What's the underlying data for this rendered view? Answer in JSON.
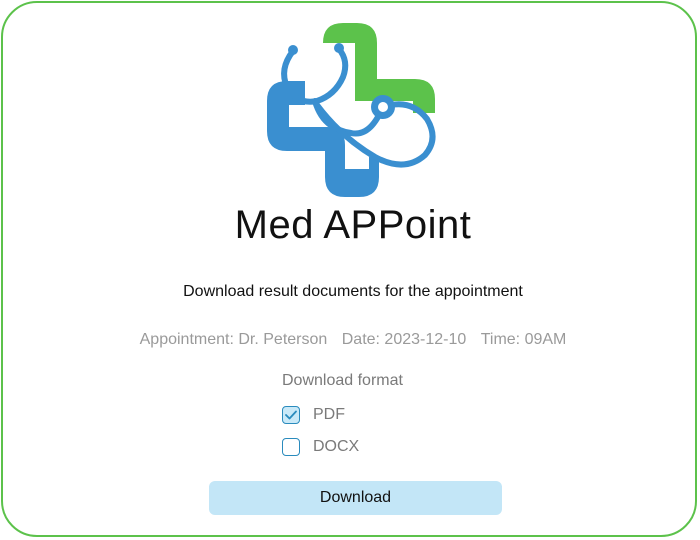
{
  "app": {
    "title": "Med APPoint",
    "logo_icon": "medical-cross-stethoscope-icon"
  },
  "subtitle": "Download result documents for the appointment",
  "appointment": {
    "doctor": "Appointment: Dr. Peterson",
    "date": "Date: 2023-12-10",
    "time": "Time: 09AM"
  },
  "download_format": {
    "label": "Download format",
    "options": [
      {
        "label": "PDF",
        "checked": true
      },
      {
        "label": "DOCX",
        "checked": false
      }
    ]
  },
  "download_button": {
    "label": "Download"
  },
  "colors": {
    "border": "#5cc24b",
    "logo_green": "#5cc24b",
    "logo_blue": "#3a8fd0",
    "checkbox_border": "#2a8bbd",
    "checkbox_checked_bg": "#c9e9f8",
    "button_bg": "#c3e6f7"
  }
}
